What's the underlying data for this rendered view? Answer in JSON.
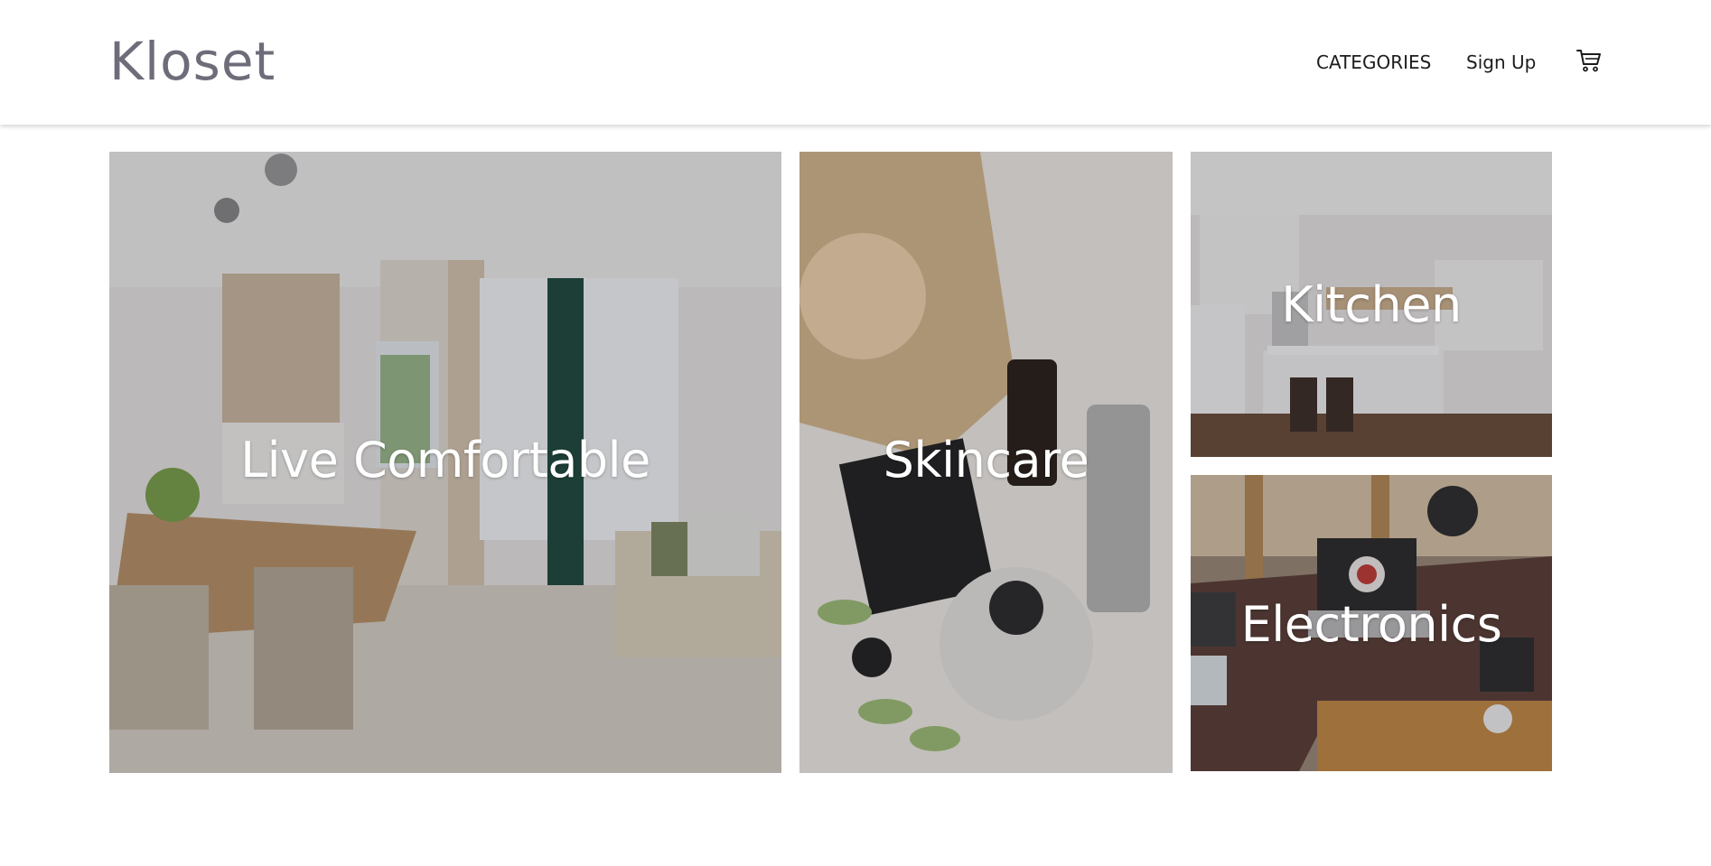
{
  "header": {
    "logo": "Kloset",
    "nav": {
      "categories": "CATEGORIES",
      "signup": "Sign Up"
    },
    "cart_icon": "cart-icon"
  },
  "tiles": [
    {
      "label": "Live Comfortable",
      "image": "living-room-photo"
    },
    {
      "label": "Skincare",
      "image": "skincare-products-photo"
    },
    {
      "label": "Kitchen",
      "image": "kitchen-photo"
    },
    {
      "label": "Electronics",
      "image": "desk-electronics-photo"
    }
  ],
  "colors": {
    "logo": "#6f6c7a",
    "nav_text": "#1c1c1c",
    "tile_label": "#ffffff"
  }
}
